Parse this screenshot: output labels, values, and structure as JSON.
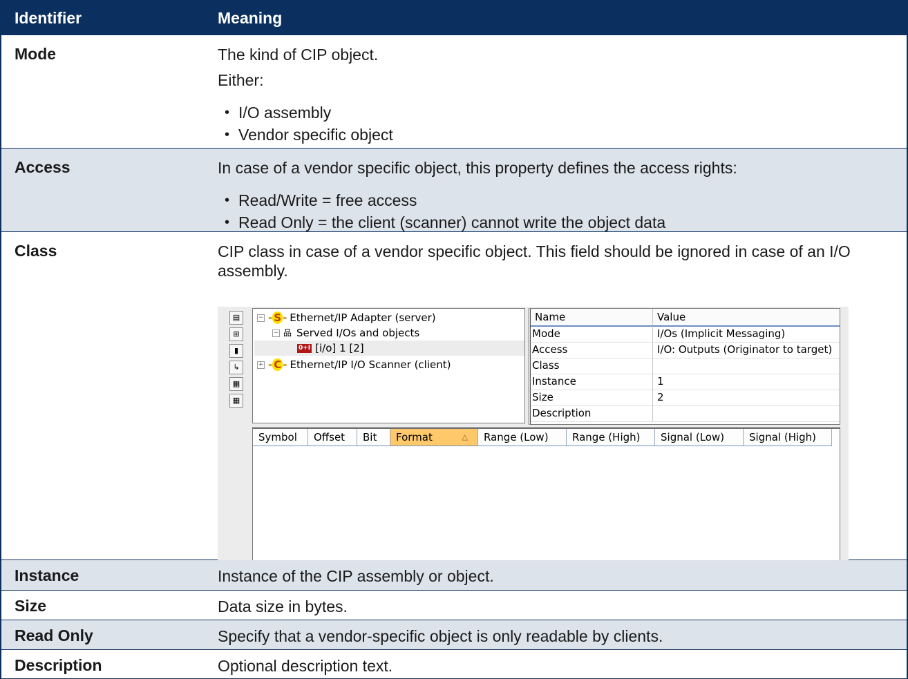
{
  "header": {
    "identifier": "Identifier",
    "meaning": "Meaning"
  },
  "rows": {
    "mode": {
      "identifier": "Mode",
      "line1": "The kind of CIP object.",
      "line2": "Either:",
      "bullets": [
        "I/O assembly",
        "Vendor specific object"
      ]
    },
    "access": {
      "identifier": "Access",
      "line1": "In case of a vendor specific object, this property defines the access rights:",
      "bullets": [
        "Read/Write = free access",
        "Read Only = the client (scanner) cannot write the object data"
      ]
    },
    "class": {
      "identifier": "Class",
      "line1": "CIP class in case of a vendor specific object. This field should be ignored in case of an I/O assembly."
    },
    "instance": {
      "identifier": "Instance",
      "line1": "Instance of the CIP assembly or object."
    },
    "size": {
      "identifier": "Size",
      "line1": "Data size in bytes."
    },
    "read_only": {
      "identifier": "Read Only",
      "line1": "Specify that a vendor-specific object is only readable by clients."
    },
    "description": {
      "identifier": "Description",
      "line1": "Optional description text."
    }
  },
  "screenshot": {
    "tree": [
      {
        "label": "Ethernet/IP Adapter (server)",
        "badge": "S"
      },
      {
        "label": "Served I/Os and objects"
      },
      {
        "label": "[i/o] 1 [2]",
        "icon_text": "0+I"
      },
      {
        "label": "Ethernet/IP I/O Scanner (client)",
        "badge": "C"
      }
    ],
    "props_header": {
      "name": "Name",
      "value": "Value"
    },
    "props": [
      {
        "name": "Mode",
        "value": "I/Os (Implicit Messaging)"
      },
      {
        "name": "Access",
        "value": "I/O: Outputs (Originator to target)"
      },
      {
        "name": "Class",
        "value": ""
      },
      {
        "name": "Instance",
        "value": "1"
      },
      {
        "name": "Size",
        "value": "2"
      },
      {
        "name": "Description",
        "value": ""
      }
    ],
    "grid_columns": [
      "Symbol",
      "Offset",
      "Bit",
      "Format",
      "Range (Low)",
      "Range (High)",
      "Signal (Low)",
      "Signal (High)"
    ]
  }
}
